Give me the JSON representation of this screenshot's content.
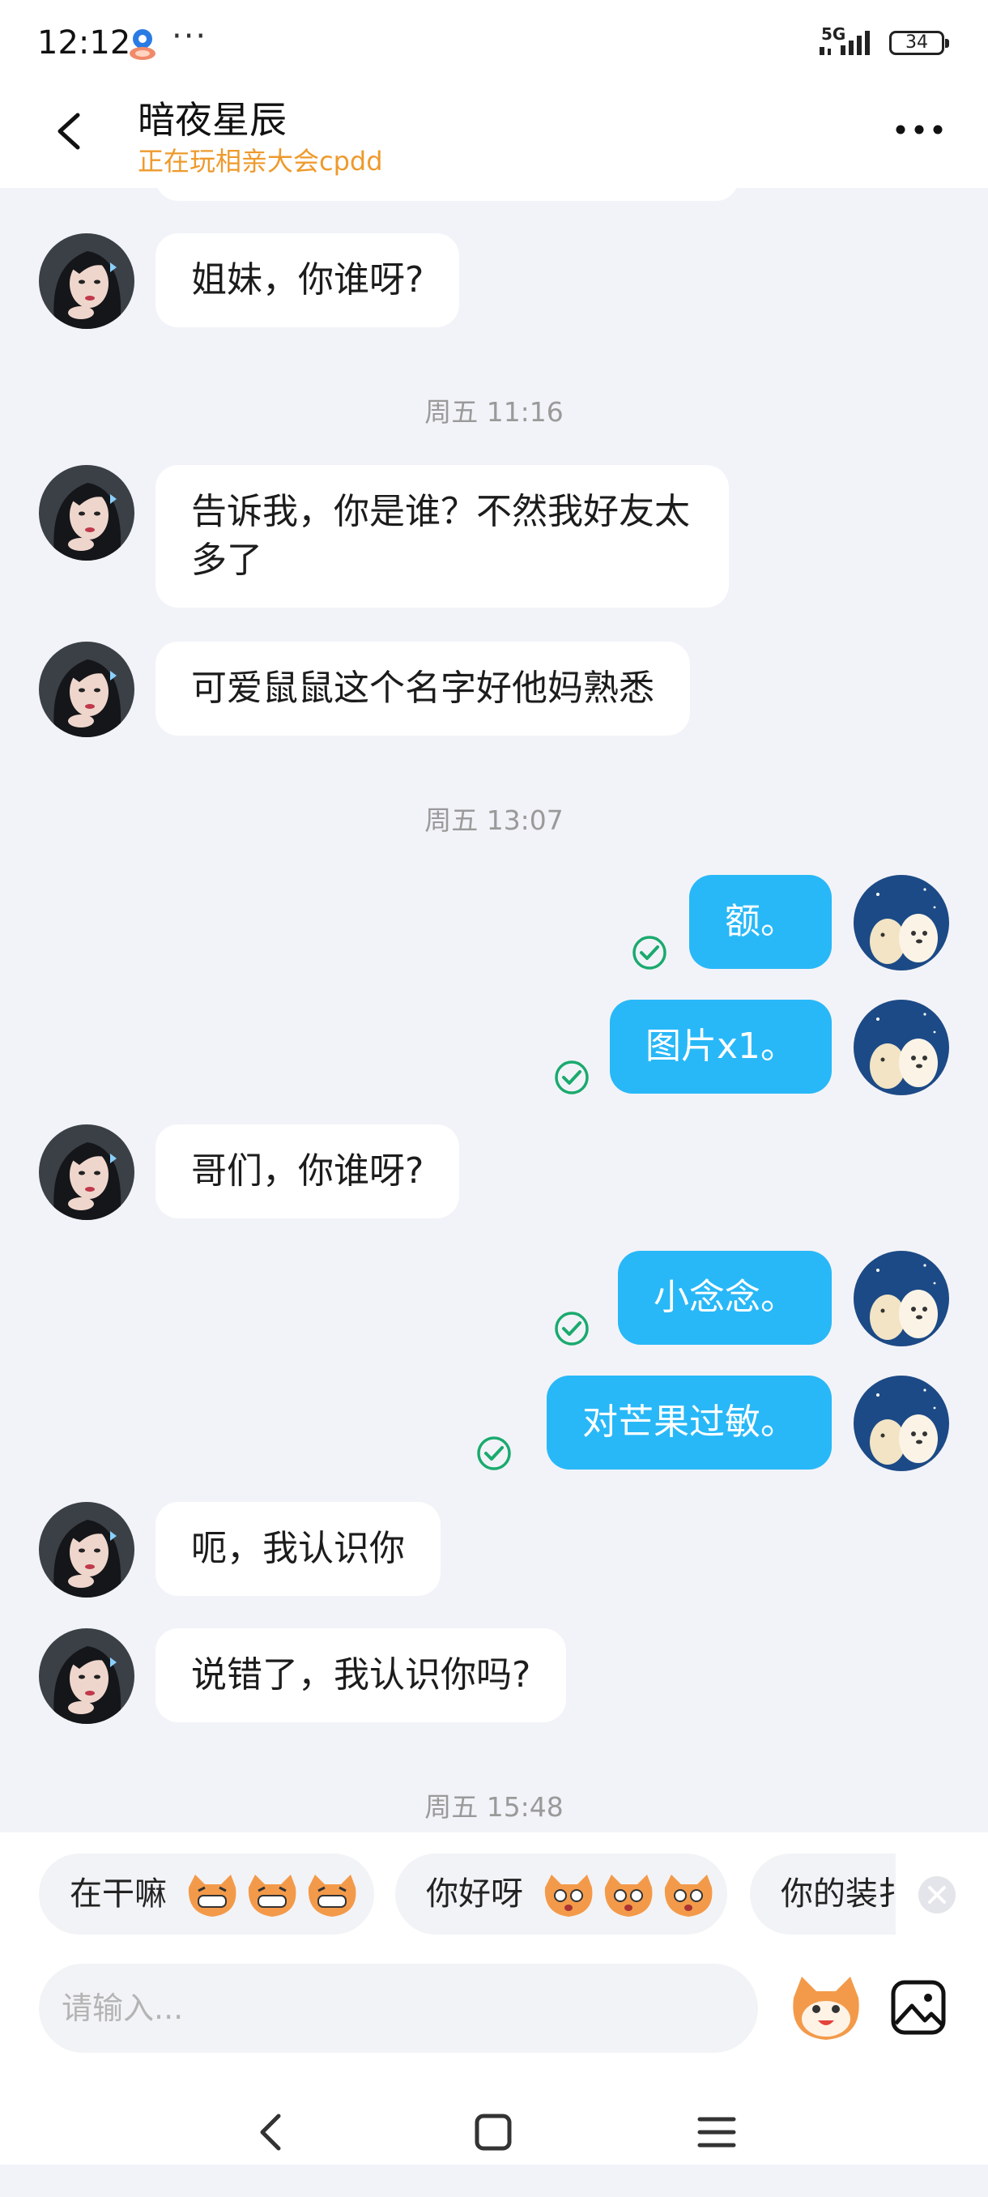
{
  "status_bar": {
    "time": "12:12",
    "network": "5G",
    "battery": "34",
    "app_icon": "blue-app-icon",
    "overflow": "···"
  },
  "header": {
    "title": "暗夜星辰",
    "subtitle": "正在玩相亲大会cpdd",
    "accent_color": "#ee9a2c"
  },
  "messages": [
    {
      "side": "in",
      "text": "姐妹，你谁呀?"
    },
    {
      "type": "time",
      "text": "周五 11:16"
    },
    {
      "side": "in",
      "text": "告诉我，你是谁？不然我好友太多了"
    },
    {
      "side": "in",
      "text": "可爱鼠鼠这个名字好他妈熟悉"
    },
    {
      "type": "time",
      "text": "周五 13:07"
    },
    {
      "side": "out",
      "text": "额。",
      "read": true
    },
    {
      "side": "out",
      "text": "图片x1。",
      "read": true
    },
    {
      "side": "in",
      "text": "哥们，你谁呀?"
    },
    {
      "side": "out",
      "text": "小念念。",
      "read": true
    },
    {
      "side": "out",
      "text": "对芒果过敏。",
      "read": true
    },
    {
      "side": "in",
      "text": "呃，我认识你"
    },
    {
      "side": "in",
      "text": "说错了，我认识你吗?"
    },
    {
      "type": "time",
      "text": "周五 15:48"
    }
  ],
  "quick_replies": [
    {
      "text": "在干嘛",
      "emoji": "grinning-cat-face"
    },
    {
      "text": "你好呀",
      "emoji": "surprised-cat-face"
    },
    {
      "text": "你的装扌",
      "emoji": ""
    }
  ],
  "input": {
    "placeholder": "请输入..."
  },
  "colors": {
    "outgoing_bubble": "#28b8f8",
    "incoming_bubble": "#ffffff",
    "read_check": "#1aaa6e",
    "background": "#f2f3f8"
  },
  "icons": {
    "back": "chevron-left-icon",
    "more": "more-horizontal-icon",
    "sticker": "sticker-face-icon",
    "image": "image-icon",
    "close": "close-circle-icon"
  }
}
